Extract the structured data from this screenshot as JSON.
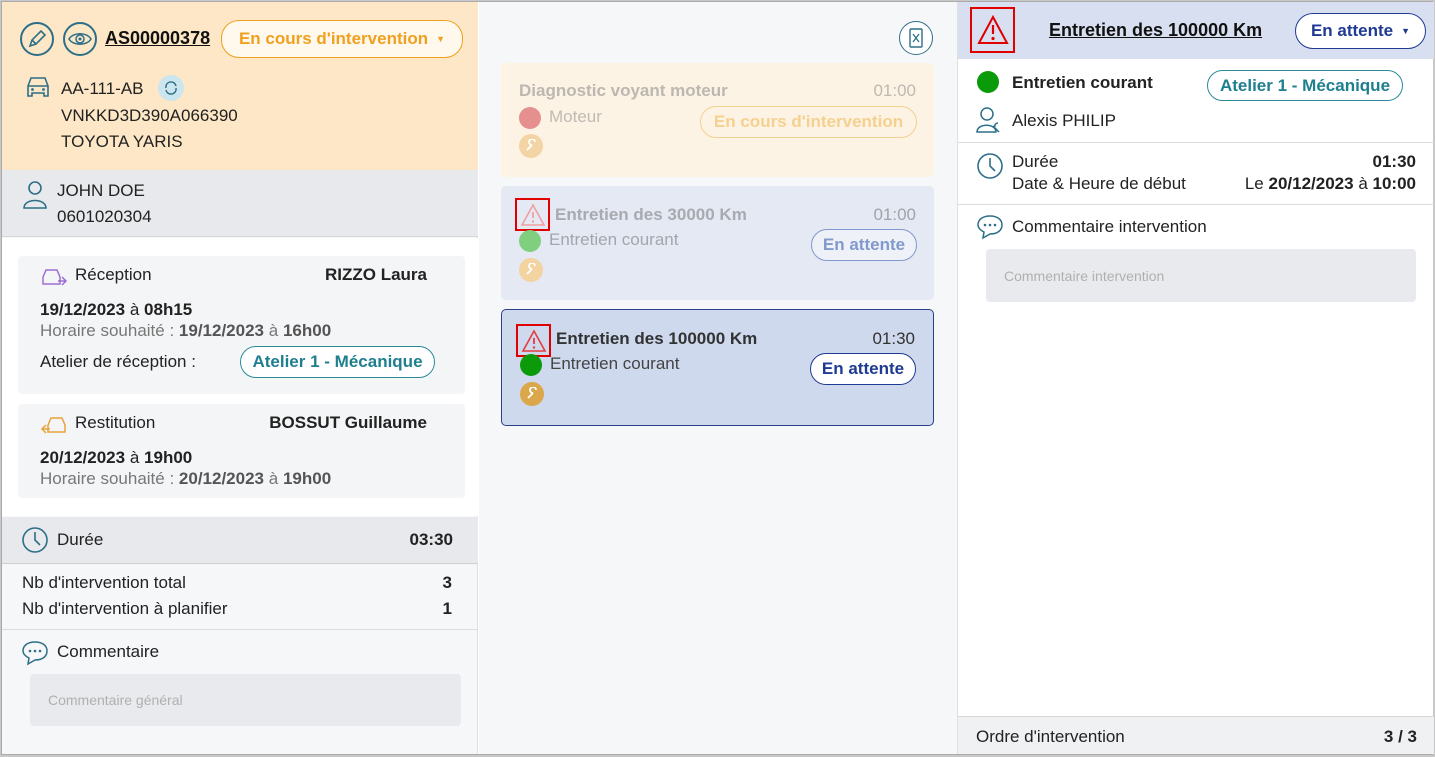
{
  "order": {
    "reference": "AS00000378",
    "status": "En cours d'intervention",
    "vehicle": {
      "plate": "AA-111-AB",
      "vin": "VNKKD3D390A066390",
      "model": "TOYOTA YARIS"
    },
    "client": {
      "name": "JOHN DOE",
      "phone": "0601020304"
    },
    "reception": {
      "label": "Réception",
      "person": "RIZZO Laura",
      "date": "19/12/2023",
      "at": "à",
      "time": "08h15",
      "wish_label": "Horaire souhaité :",
      "wish_date": "19/12/2023",
      "wish_time": "16h00",
      "atelier_label": "Atelier de réception :",
      "atelier": "Atelier 1 - Mécanique"
    },
    "restitution": {
      "label": "Restitution",
      "person": "BOSSUT Guillaume",
      "date": "20/12/2023",
      "at": "à",
      "time": "19h00",
      "wish_label": "Horaire souhaité :",
      "wish_date": "20/12/2023",
      "wish_time": "19h00"
    },
    "duree": {
      "label": "Durée",
      "value": "03:30"
    },
    "stats": [
      {
        "label": "Nb d'intervention total",
        "value": "3"
      },
      {
        "label": "Nb d'intervention à planifier",
        "value": "1"
      }
    ],
    "comment": {
      "label": "Commentaire",
      "placeholder": "Commentaire général"
    }
  },
  "interventions": [
    {
      "title": "Diagnostic voyant moteur",
      "time": "01:00",
      "category": "Moteur",
      "status": "En cours d'intervention",
      "dot_color": "#e06a6a",
      "warning": false
    },
    {
      "title": "Entretien des 30000 Km",
      "time": "01:00",
      "category": "Entretien courant",
      "status": "En attente",
      "dot_color": "#5cc45c",
      "warning": true
    },
    {
      "title": "Entretien des 100000 Km",
      "time": "01:30",
      "category": "Entretien courant",
      "status": "En attente",
      "dot_color": "#0a9a0a",
      "warning": true,
      "selected": true
    }
  ],
  "detail": {
    "title": "Entretien des 100000 Km",
    "status": "En attente",
    "category": "Entretien courant",
    "atelier": "Atelier 1 - Mécanique",
    "technician": "Alexis PHILIP",
    "duree_label": "Durée",
    "duree_value": "01:30",
    "start_label": "Date & Heure de début",
    "start_prefix": "Le",
    "start_date": "20/12/2023",
    "start_at": "à",
    "start_time": "10:00",
    "comment_label": "Commentaire intervention",
    "comment_placeholder": "Commentaire intervention",
    "order_label": "Ordre d'intervention",
    "order_value": "3 / 3"
  },
  "colors": {
    "accent_orange": "#f0a020",
    "accent_blue": "#1f3a93",
    "teal": "#2d6f88",
    "warning_red": "#e00000"
  }
}
